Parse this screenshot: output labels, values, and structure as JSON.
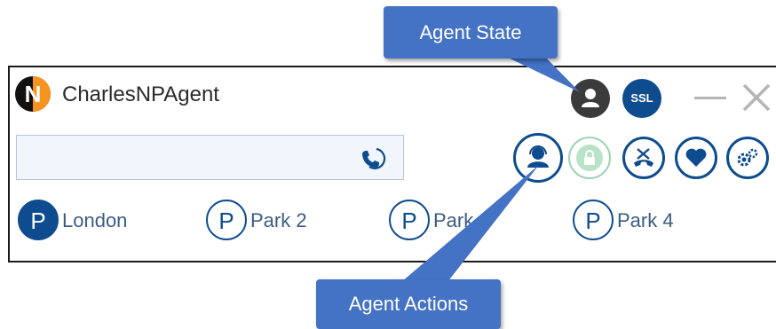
{
  "window": {
    "title": "CharlesNPAgent",
    "logo_letter": "N",
    "ssl_badge": "SSL"
  },
  "dialer": {
    "value": "",
    "placeholder": ""
  },
  "lines": [
    {
      "letter": "P",
      "label": "London",
      "active": true
    },
    {
      "letter": "P",
      "label": "Park 2",
      "active": false
    },
    {
      "letter": "P",
      "label": "Park 3",
      "active": false
    },
    {
      "letter": "P",
      "label": "Park 4",
      "active": false
    }
  ],
  "actions": [
    {
      "icon": "agent-headset-icon",
      "enabled": true
    },
    {
      "icon": "lock-icon",
      "enabled": false
    },
    {
      "icon": "hangup-icon",
      "enabled": true
    },
    {
      "icon": "heart-icon",
      "enabled": true
    },
    {
      "icon": "gears-icon",
      "enabled": true
    }
  ],
  "callouts": {
    "agent_state": "Agent State",
    "agent_actions": "Agent Actions"
  },
  "colors": {
    "brand_blue": "#0e4c8f",
    "callout_blue": "#4472c4",
    "logo_orange": "#f7941d",
    "disabled_green": "#9fd3b3"
  }
}
